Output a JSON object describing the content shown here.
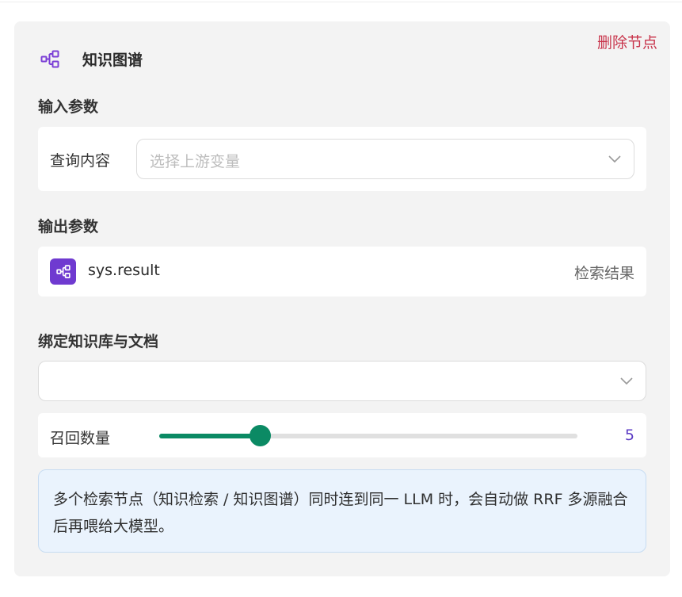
{
  "node": {
    "title": "知识图谱",
    "delete_label": "删除节点",
    "icon": "knowledge-graph-icon"
  },
  "input_params": {
    "section_title": "输入参数",
    "query_label": "查询内容",
    "query_placeholder": "选择上游变量"
  },
  "output_params": {
    "section_title": "输出参数",
    "variable_name": "sys.result",
    "variable_desc": "检索结果"
  },
  "knowledge_binding": {
    "section_title": "绑定知识库与文档",
    "selected_value": ""
  },
  "recall": {
    "label": "召回数量",
    "value": "5",
    "level_fraction": 0.24
  },
  "note": {
    "text": "多个检索节点（知识检索 / 知识图谱）同时连到同一 LLM 时，会自动做 RRF 多源融合后再喂给大模型。"
  },
  "colors": {
    "accent_purple": "#6f3ad0",
    "slider_green": "#0b8a64",
    "delete_red": "#c8344b",
    "note_bg": "#eaf3fd"
  }
}
